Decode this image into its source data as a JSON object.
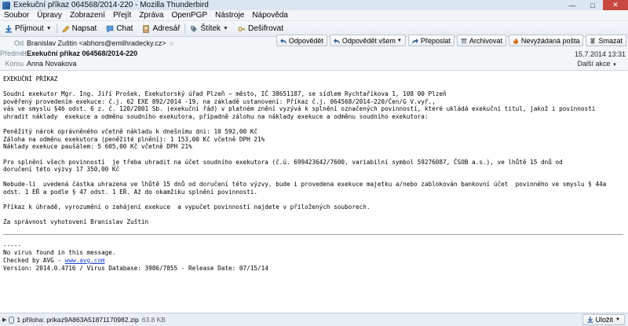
{
  "window": {
    "title": "Exekuční příkaz 064568/2014-220 - Mozilla Thunderbird"
  },
  "menu": [
    "Soubor",
    "Úpravy",
    "Zobrazení",
    "Přejít",
    "Zpráva",
    "OpenPGP",
    "Nástroje",
    "Nápověda"
  ],
  "toolbar": {
    "receive": "Přijmout",
    "write": "Napsat",
    "chat": "Chat",
    "addressbook": "Adresář",
    "tag": "Štítek",
    "decrypt": "Dešifrovat"
  },
  "header": {
    "from_label": "Od",
    "from": "Branislav Zuštin <abhors@emilhradecky.cz>",
    "subject_label": "Předmět",
    "subject": "Exekuční příkaz 064568/2014-220",
    "to_label": "Komu",
    "to": "Anna Novakova",
    "date": "15.7.2014 13:31",
    "more_actions": "Další akce",
    "actions": {
      "reply": "Odpovědět",
      "reply_all": "Odpovědět všem",
      "forward": "Přeposlat",
      "archive": "Archivovat",
      "junk": "Nevyžádaná pošta",
      "delete": "Smazat"
    }
  },
  "message": {
    "heading": "EXEKUČNÍ PŘÍKAZ",
    "p1_l1": "Soudní exekutor Mgr. Ing. Jiří Prošek, Exekutorský úřad Plzeň – město, IČ 38651187, se sídlem Rychtaříkova 1, 108 00 Plzeň",
    "p1_l2": "pověřený provedením exekuce: č.j. 62 EXE 892/2014 -19, na základě ustanovení: Příkaz č.j. 064568/2014-220/Čen/G V.vyř.,",
    "p1_l3": "vás ve smyslu §46 odst. 6 z. č. 120/2001 Sb. (exekuční řád) v platném znění vyzývá k splnění označených povinností, které ukládá exekuční titul, jakož i povinnosti",
    "p1_l4": "uhradit náklady  exekuce a odměnu soudního exekutora, případně zálohu na náklady exekuce a odměnu soudního exekutora:",
    "amount1": "Peněžitý nárok oprávněného včetně nákladu k dnešnímu dni: 10 592,00 Kč",
    "amount2": "Záloha na odměnu exekutora (peněžité plnění): 1 153,00 Kč včetně DPH 21%",
    "amount3": "Náklady exekuce paušálem: 5 605,00 Kč včetně DPH 21%",
    "p2_l1": "Pro splnění všech povinností  je třeba uhradit na účet soudního exekutora (č.ú. 699423642/7600, variabilní symbol 59276087, ČSOB a.s.), ve lhůtě 15 dnů od",
    "p2_l2": "doručení této výzvy 17 350,00 Kč",
    "p3_l1": "Nebude-li  uvedená částka uhrazena ve lhůtě 15 dnů od doručení této výzvy, bude i provedena exekuce majetku a/nebo zablokován bankovní účet  povinného ve smyslu § 44a",
    "p3_l2": "odst. 1 EŘ a podle § 47 odst. 1 EŘ. Až do okamžiku splnění povinnosti.",
    "p4": "Příkaz k úhradě, vyrozumění o zahájení exekuce  a vypučet povinností najdete v přiložených souborech.",
    "p5": "Za správnost vyhotovení Branislav Zuštin",
    "sig_dash": "-----",
    "sig1": "No virus found in this message.",
    "sig2_prefix": "Checked by AVG - ",
    "sig2_link": "www.avg.com",
    "sig3": "Version: 2014.0.4716 / Virus Database: 3986/7855 - Release Date: 07/15/14"
  },
  "attachment": {
    "label": "1 příloha: prikaz9A863A5187117098​2.zip",
    "size": "63.8 KB",
    "save": "Uložit"
  }
}
